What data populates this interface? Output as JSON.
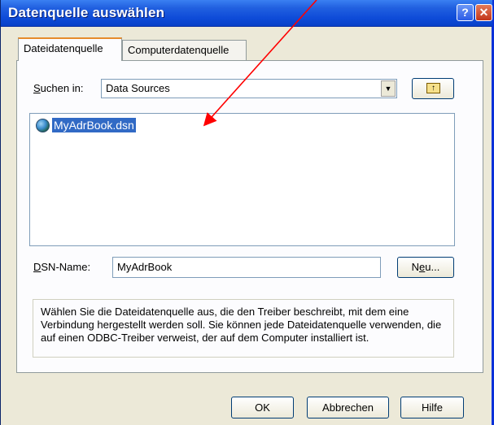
{
  "window": {
    "title": "Datenquelle auswählen",
    "help_glyph": "?",
    "close_glyph": "✕"
  },
  "tabs": [
    {
      "label": "Dateidatenquelle",
      "active": true
    },
    {
      "label": "Computerdatenquelle",
      "active": false
    }
  ],
  "lookin": {
    "label_prefix": "",
    "label_access": "S",
    "label_rest": "uchen in:",
    "value": "Data Sources",
    "arrow_glyph": "▼",
    "updir_glyph": "↑"
  },
  "files": [
    {
      "name": "MyAdrBook.dsn",
      "selected": true,
      "icon": "dsn-globe-icon"
    }
  ],
  "dsn": {
    "label_access": "D",
    "label_rest": "SN-Name:",
    "value": "MyAdrBook"
  },
  "buttons": {
    "new_prefix": "N",
    "new_access": "e",
    "new_rest": "u...",
    "ok": "OK",
    "cancel": "Abbrechen",
    "help": "Hilfe"
  },
  "description": "Wählen Sie die Dateidatenquelle aus, die den Treiber beschreibt, mit dem eine Verbindung hergestellt werden soll. Sie können jede Dateidatenquelle verwenden, die auf einen ODBC-Treiber verweist, der auf dem Computer installiert ist.",
  "annotation": {
    "color": "#ff0000",
    "type": "arrow"
  }
}
